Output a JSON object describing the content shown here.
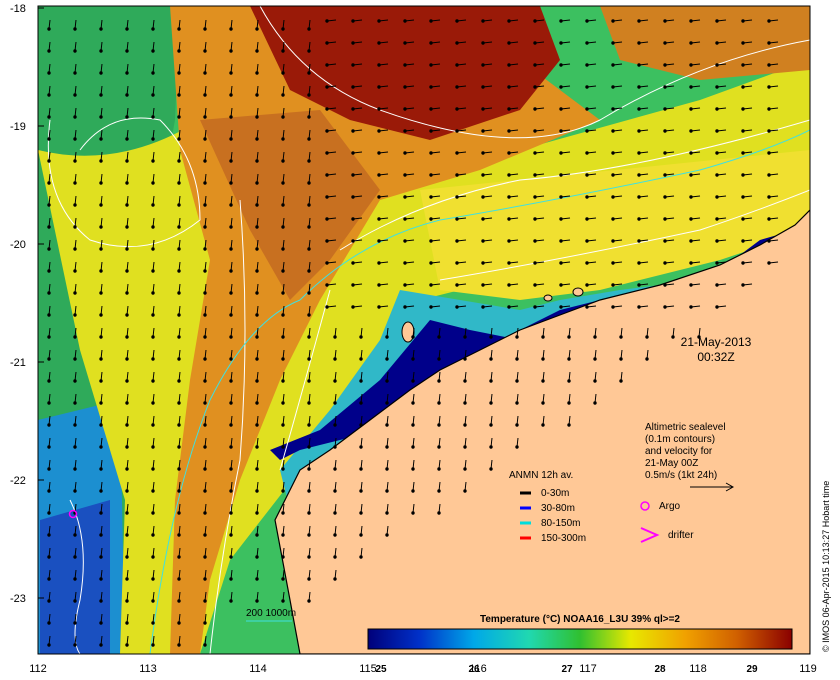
{
  "map": {
    "lat_ticks": [
      "-18",
      "-19",
      "-20",
      "-21",
      "-22",
      "-23"
    ],
    "lon_ticks": [
      "112",
      "113",
      "114",
      "115",
      "116",
      "117",
      "118",
      "119"
    ],
    "date": "21-May-2013",
    "time": "00:32Z",
    "altimetry_lines": [
      "Altimetric sealevel",
      "(0.1m contours)",
      "and velocity for",
      "21-May 00Z",
      "0.5m/s (1kt 24h)"
    ],
    "anmn": {
      "title": "ANMN 12h av.",
      "items": [
        {
          "label": "0-30m",
          "color": "#000000"
        },
        {
          "label": "30-80m",
          "color": "#0000ff"
        },
        {
          "label": "80-150m",
          "color": "#00dddd"
        },
        {
          "label": "150-300m",
          "color": "#ff0000"
        }
      ]
    },
    "argo_label": "Argo",
    "argo_color": "#ff00ff",
    "drifter_label": "drifter",
    "drifter_color": "#ff00ff",
    "bathy_label": "200  1000m",
    "colorbar": {
      "title": "Temperature (°C) NOAA16_L3U 39% ql>=2",
      "ticks": [
        "25",
        "26",
        "27",
        "28",
        "29"
      ]
    },
    "side_note": "© IMOS 06-Apr-2015 10:13:27 Hobart time"
  }
}
